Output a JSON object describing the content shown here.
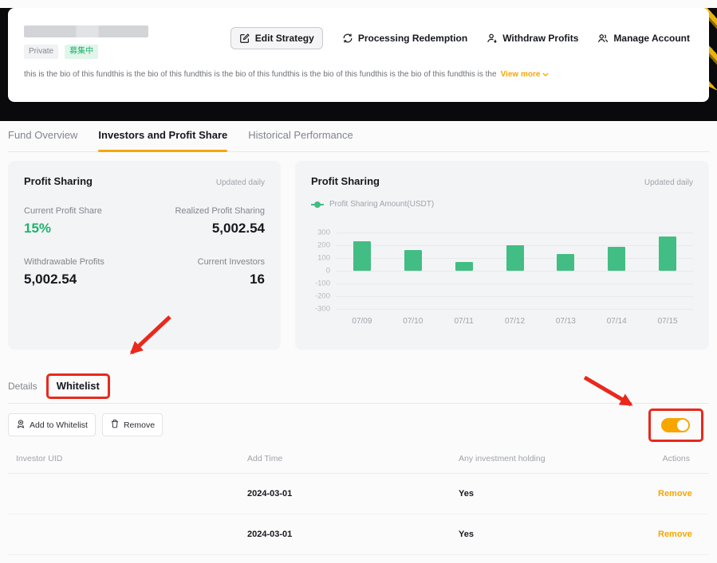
{
  "colors": {
    "accent_orange": "#f7a600",
    "green": "#20b26c",
    "bar_green": "#42bd83",
    "annotation_red": "#e8291c",
    "dark_text": "#16181d",
    "gray_text": "#81858c"
  },
  "header": {
    "badges": [
      {
        "label": "Private",
        "type": "gray"
      },
      {
        "label": "募集中",
        "type": "green"
      }
    ],
    "actions": [
      {
        "label": "Edit Strategy",
        "icon": "edit-icon"
      },
      {
        "label": "Processing Redemption",
        "icon": "redemption-icon"
      },
      {
        "label": "Withdraw Profits",
        "icon": "withdraw-icon"
      },
      {
        "label": "Manage Account",
        "icon": "manage-account-icon"
      }
    ],
    "bio": "this is the bio of this fundthis is the bio of this fundthis is the bio of this fundthis is the bio of this fundthis is the bio of this fundthis is the",
    "view_more_label": "View more"
  },
  "tabs": [
    {
      "label": "Fund Overview",
      "active": false
    },
    {
      "label": "Investors and Profit Share",
      "active": true
    },
    {
      "label": "Historical Performance",
      "active": false
    }
  ],
  "profit_summary": {
    "title": "Profit Sharing",
    "updated": "Updated daily",
    "stats": [
      {
        "label": "Current Profit Share",
        "value": "15%"
      },
      {
        "label": "Realized Profit Sharing",
        "value": "5,002.54"
      },
      {
        "label": "Withdrawable Profits",
        "value": "5,002.54"
      },
      {
        "label": "Current Investors",
        "value": "16"
      }
    ]
  },
  "chart_card": {
    "title": "Profit Sharing",
    "updated": "Updated daily",
    "legend": "Profit Sharing Amount(USDT)"
  },
  "chart_data": {
    "type": "bar",
    "title": "Profit Sharing",
    "legend": [
      "Profit Sharing Amount(USDT)"
    ],
    "categories": [
      "07/09",
      "07/10",
      "07/11",
      "07/12",
      "07/13",
      "07/14",
      "07/15"
    ],
    "values": [
      230,
      160,
      70,
      200,
      130,
      185,
      270
    ],
    "xlabel": "",
    "ylabel": "",
    "ylim": [
      -300,
      300
    ],
    "yticks": [
      300,
      200,
      100,
      0,
      -100,
      -200,
      -300
    ],
    "grid": true,
    "bar_color": "#42bd83"
  },
  "sub_tabs": [
    {
      "label": "Details",
      "active": false
    },
    {
      "label": "Whitelist",
      "active": true
    }
  ],
  "toolbar": {
    "add_label": "Add to Whitelist",
    "remove_label": "Remove",
    "toggle_on": true
  },
  "table": {
    "headers": [
      "Investor UID",
      "Add Time",
      "Any investment holding",
      "Actions"
    ],
    "rows": [
      {
        "add_time": "2024-03-01",
        "holding": "Yes",
        "action": "Remove"
      },
      {
        "add_time": "2024-03-01",
        "holding": "Yes",
        "action": "Remove"
      }
    ]
  },
  "annotations": {
    "color": "#e8291c",
    "highlighted": [
      "Whitelist tab",
      "Whitelist toggle"
    ]
  }
}
